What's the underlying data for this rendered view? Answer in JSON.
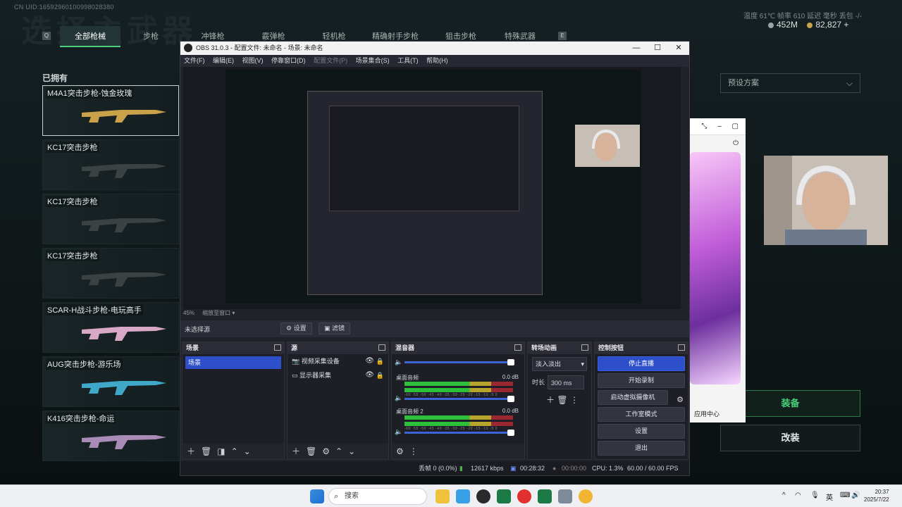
{
  "game": {
    "uid": "CN UID:1659296010099802838​0",
    "title_watermark": "选择主武器",
    "stats": "温度  61℃   帧率 610   延迟 毫秒   丢包 -/-",
    "coin1": "452M",
    "coin2": "82,827 +",
    "tabs": [
      "全部枪械",
      "步枪",
      "冲锋枪",
      "霰弹枪",
      "轻机枪",
      "精确射手步枪",
      "狙击步枪",
      "特殊武器"
    ],
    "key_left": "Q",
    "key_right": "E",
    "owned_label": "已拥有",
    "weapons": [
      "M4A1突击步枪-蚀金玫瑰",
      "KC17突击步枪",
      "KC17突击步枪",
      "KC17突击步枪",
      "SCAR-H战斗步枪-电玩高手",
      "AUG突击步枪-游乐场",
      "K416突击步枪-命运"
    ],
    "presets_label": "预设方案",
    "equip_label": "装备",
    "modify_label": "改装",
    "colors": {
      "accent": "#4ad07b",
      "bg": "#0f1719"
    }
  },
  "phone": {
    "app_center": "应用中心"
  },
  "obs": {
    "title": "OBS 31.0.3 - 配置文件: 未命名 - 场景: 未命名",
    "menu": [
      "文件(F)",
      "编辑(E)",
      "视图(V)",
      "停靠窗口(D)",
      "配置文件(P)",
      "场景集合(S)",
      "工具(T)",
      "帮助(H)"
    ],
    "zoom": "45%",
    "zoom_mode": "缩放至窗口",
    "no_source": "未选择源",
    "props_btn": "设置",
    "filters_btn": "滤镜",
    "scenes": {
      "title": "场景",
      "items": [
        "场景"
      ]
    },
    "sources": {
      "title": "源",
      "items": [
        "视频采集设备",
        "显示器采集"
      ]
    },
    "mixer": {
      "title": "混音器",
      "channels": [
        {
          "name": "桌面音频",
          "db": "0.0 dB"
        },
        {
          "name": "桌面音频 2",
          "db": "0.0 dB"
        }
      ],
      "scale": "-60 -55 -50 -45 -40 -35 -30 -25 -20 -15 -10 -5 0"
    },
    "transitions": {
      "title": "转场动画",
      "selected": "淡入淡出",
      "duration_label": "时长",
      "duration": "300 ms"
    },
    "controls": {
      "title": "控制按钮",
      "buttons": [
        "停止直播",
        "开始录制",
        "启动虚拟摄像机",
        "工作室模式",
        "设置",
        "退出"
      ]
    },
    "status": {
      "frames": "丢帧 0 (0.0%)",
      "bitrate": "12617 kbps",
      "live_time": "00:28:32",
      "rec_time": "00:00:00",
      "cpu": "CPU: 1.3%",
      "fps": "60.00 / 60.00 FPS"
    }
  },
  "taskbar": {
    "search_placeholder": "搜索",
    "ime": "英",
    "time": "20:37",
    "date": "2025/7/22"
  }
}
